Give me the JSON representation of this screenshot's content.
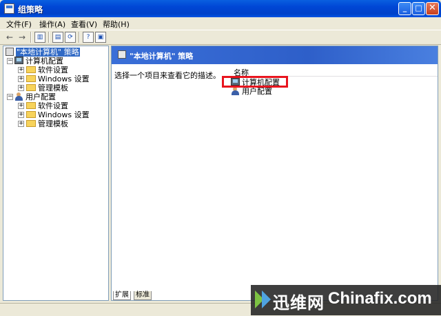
{
  "window": {
    "title": "组策略"
  },
  "title_buttons": {
    "minimize": "_",
    "maximize": "□",
    "close": "✕"
  },
  "menu": [
    {
      "label": "文件(F)"
    },
    {
      "label": "操作(A)"
    },
    {
      "label": "查看(V)"
    },
    {
      "label": "帮助(H)"
    }
  ],
  "toolbar": {
    "back": "←",
    "forward": "→",
    "icons": [
      "show-hide-tree-icon",
      "properties-icon",
      "refresh-icon",
      "help-icon",
      "view-icon"
    ]
  },
  "tree": {
    "root": "\"本地计算机\" 策略",
    "computer": "计算机配置",
    "computer_children": [
      "软件设置",
      "Windows 设置",
      "管理模板"
    ],
    "user": "用户配置",
    "user_children": [
      "软件设置",
      "Windows 设置",
      "管理模板"
    ]
  },
  "right": {
    "header": "\"本地计算机\" 策略",
    "description": "选择一个项目来查看它的描述。",
    "column_name": "名称",
    "items": [
      "计算机配置",
      "用户配置"
    ]
  },
  "tabs": [
    "扩展",
    "标准"
  ],
  "watermark": {
    "cn": "迅维网",
    "en": "Chinafix.com"
  },
  "colors": {
    "title_bar": "#0054E3",
    "highlight_box": "#E8141E",
    "selection": "#316AC5"
  }
}
